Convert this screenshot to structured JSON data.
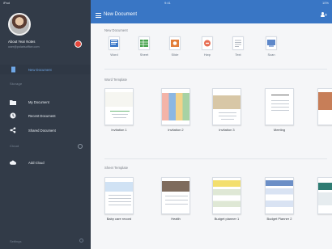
{
  "status_bar": {
    "left": "iPad ",
    "time": "9:41",
    "right": "10%"
  },
  "sidebar": {
    "user_name": "About Year Notes",
    "user_email": "user@polarisoffice.com",
    "items": [
      {
        "label": "New Document"
      },
      {
        "label": "My Document"
      },
      {
        "label": "Recent Document"
      },
      {
        "label": "Shared Document"
      },
      {
        "label": "Add Cloud"
      }
    ],
    "section_labels": [
      "Storage",
      "Cloud"
    ],
    "settings_label": "Settings"
  },
  "header": {
    "title": "New Document"
  },
  "new_document": {
    "heading": "New Document",
    "types": [
      {
        "label": "Word",
        "color": "#3b78c8"
      },
      {
        "label": "Sheet",
        "color": "#48a34f"
      },
      {
        "label": "Slide",
        "color": "#e27d39"
      },
      {
        "label": "Hwp",
        "color": "#e76d52"
      },
      {
        "label": "Text",
        "color": "#9aa3ae"
      },
      {
        "label": "Scan",
        "color": "#5d87c9"
      }
    ]
  },
  "word_templates": {
    "heading": "Word Template",
    "items": [
      {
        "label": "Invitation 1"
      },
      {
        "label": "Invitation 2"
      },
      {
        "label": "Invitation 3"
      },
      {
        "label": "Meeting"
      },
      {
        "label": ""
      }
    ]
  },
  "sheet_templates": {
    "heading": "Sheet Template",
    "items": [
      {
        "label": "Baby care record"
      },
      {
        "label": "Health"
      },
      {
        "label": "Budget planner 1"
      },
      {
        "label": "Budget Planner 2"
      },
      {
        "label": ""
      }
    ]
  },
  "colors": {
    "sidebar": "#323b48",
    "header": "#3976c5",
    "accent": "#6fa7e6"
  }
}
